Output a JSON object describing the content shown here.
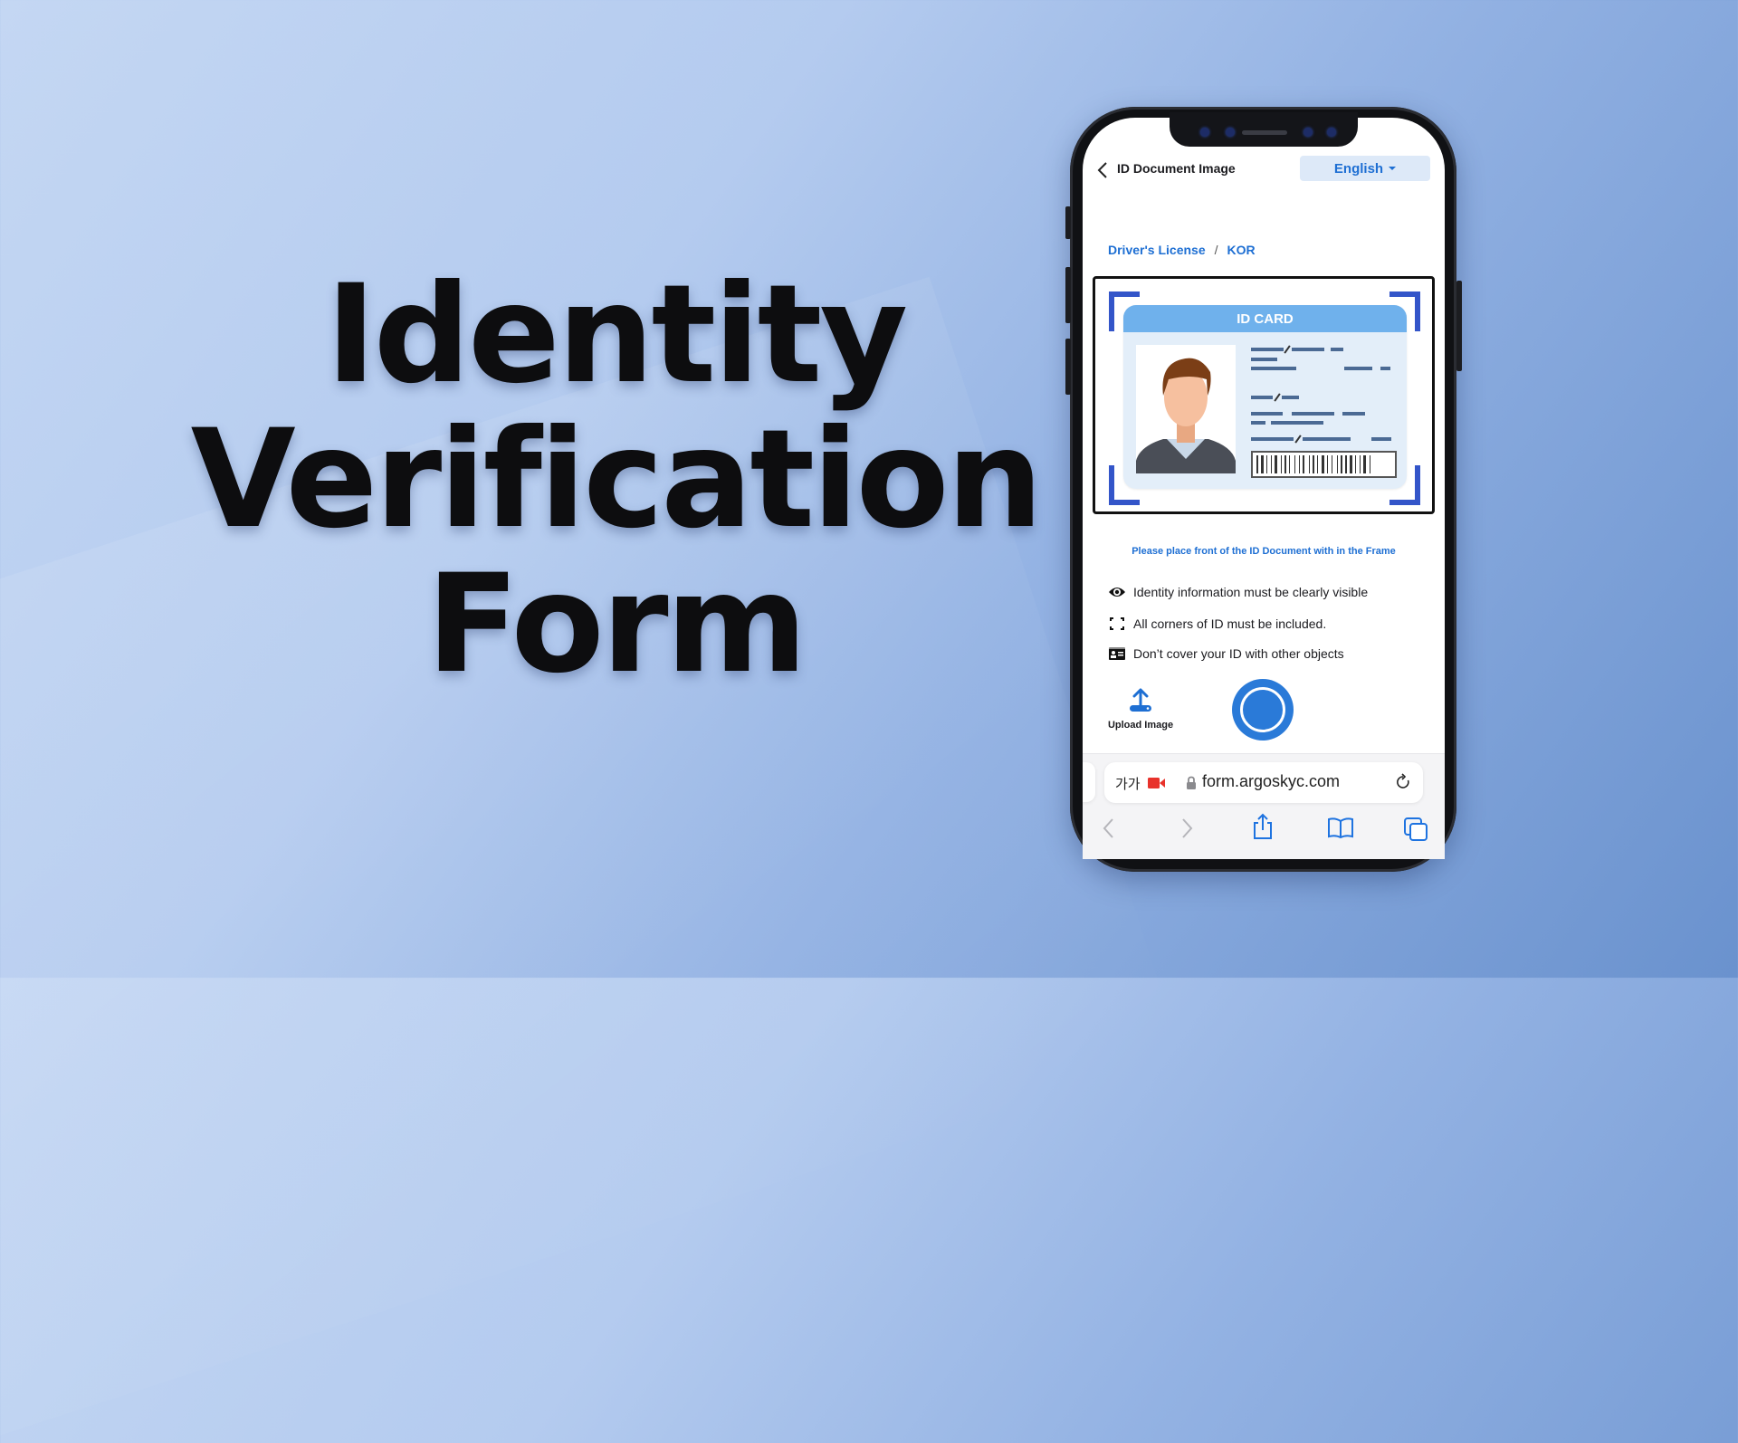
{
  "headline": {
    "line1": "Identity",
    "line2": "Verification",
    "line3": "Form"
  },
  "app": {
    "header_title": "ID Document Image",
    "back_icon": "chevron-left-icon",
    "language": {
      "selected": "English",
      "caret_icon": "caret-down-icon"
    },
    "breadcrumb": {
      "document_type": "Driver's License",
      "separator": "/",
      "country": "KOR"
    },
    "id_card": {
      "title": "ID CARD"
    },
    "instruction": "Please place front of the ID Document with in the Frame",
    "rules": [
      {
        "icon": "eye-icon",
        "text": "Identity information must be clearly visible"
      },
      {
        "icon": "corners-icon",
        "text": "All corners of ID must be included."
      },
      {
        "icon": "id-card-icon",
        "text": "Don’t cover your ID with other objects"
      }
    ],
    "upload": {
      "icon": "upload-icon",
      "label": "Upload Image"
    },
    "capture_button": "shutter-button"
  },
  "browser": {
    "text_size_label": "가가",
    "recording_icon": "camera-recording-icon",
    "lock_icon": "lock-icon",
    "url": "form.argoskyc.com",
    "reload_icon": "reload-icon",
    "toolbar": [
      "back-icon",
      "forward-icon",
      "share-icon",
      "bookmarks-icon",
      "tabs-icon"
    ]
  },
  "colors": {
    "accent": "#1e6fd3",
    "frame_corners": "#3355c9",
    "card_header": "#6fb1ec",
    "card_body": "#e3eef9",
    "capture_button": "#2a7ad8",
    "recording": "#e8322b",
    "background_light": "#c4d7f3",
    "background_dark": "#6a92ce"
  }
}
